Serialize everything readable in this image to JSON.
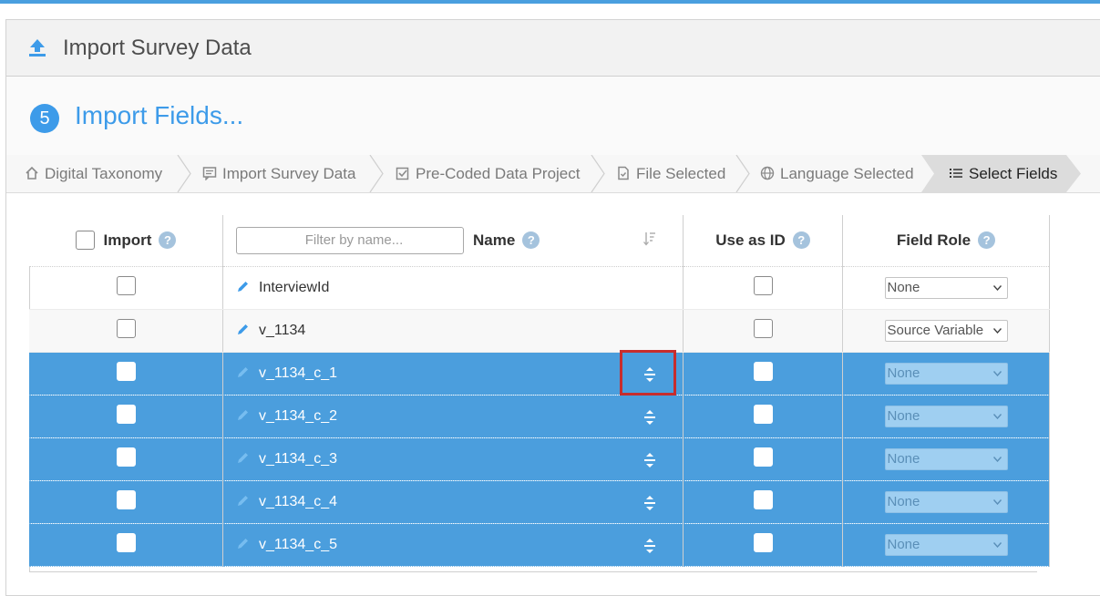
{
  "header": {
    "title": "Import Survey Data"
  },
  "step": {
    "number": "5",
    "title": "Import Fields..."
  },
  "breadcrumbs": [
    {
      "label": "Digital Taxonomy",
      "icon": "home-icon"
    },
    {
      "label": "Import Survey Data",
      "icon": "survey-icon"
    },
    {
      "label": "Pre-Coded Data Project",
      "icon": "checkbox-icon"
    },
    {
      "label": "File Selected",
      "icon": "file-icon"
    },
    {
      "label": "Language Selected",
      "icon": "globe-icon"
    },
    {
      "label": "Select Fields",
      "icon": "list-icon",
      "active": true
    }
  ],
  "table": {
    "headers": {
      "import": "Import",
      "name": "Name",
      "use_as_id": "Use as ID",
      "field_role": "Field Role"
    },
    "filter_placeholder": "Filter by name...",
    "help_glyph": "?",
    "rows": [
      {
        "name": "InterviewId",
        "role": "None",
        "selected": false
      },
      {
        "name": "v_1134",
        "role": "Source Variable",
        "selected": false
      },
      {
        "name": "v_1134_c_1",
        "role": "None",
        "selected": true
      },
      {
        "name": "v_1134_c_2",
        "role": "None",
        "selected": true
      },
      {
        "name": "v_1134_c_3",
        "role": "None",
        "selected": true
      },
      {
        "name": "v_1134_c_4",
        "role": "None",
        "selected": true
      },
      {
        "name": "v_1134_c_5",
        "role": "None",
        "selected": true
      }
    ]
  },
  "colors": {
    "accent": "#3d9be9",
    "selected_row": "#4b9edd",
    "highlight": "#c72d2d"
  }
}
